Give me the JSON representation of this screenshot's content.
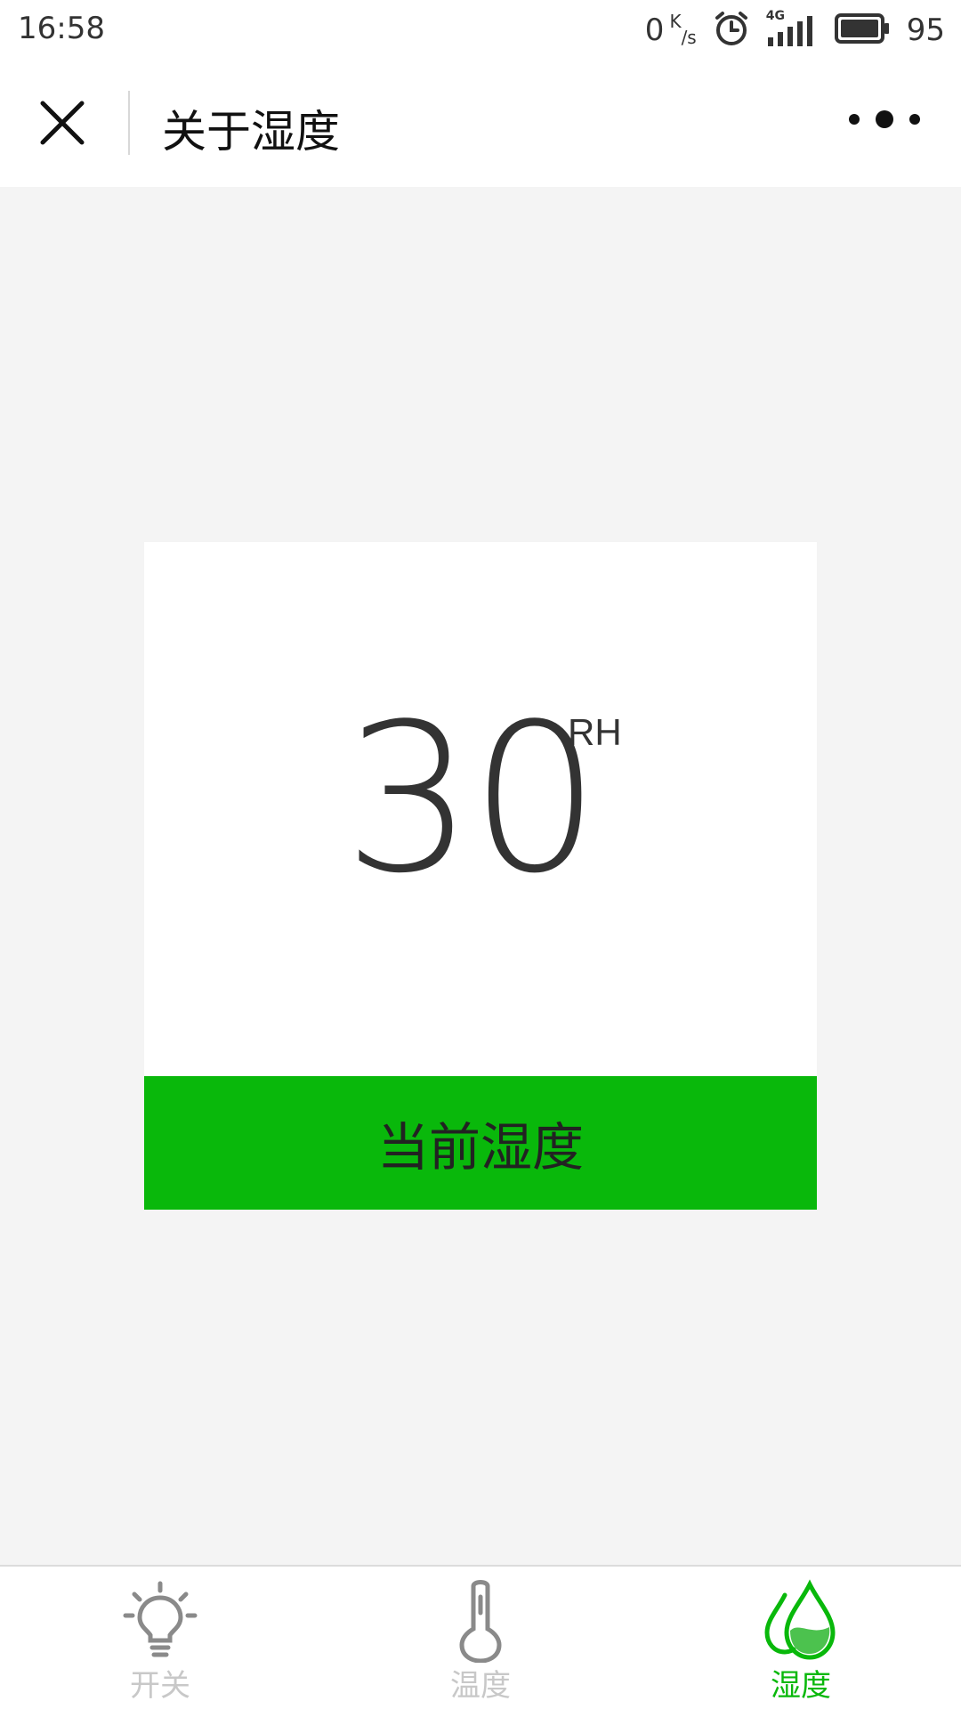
{
  "status_bar": {
    "time": "16:58",
    "net_speed_value": "0",
    "net_speed_unit_k": "K",
    "net_speed_unit_s": "/s",
    "network_type": "4G",
    "battery_percent": "95"
  },
  "nav": {
    "title": "关于湿度",
    "close_icon": "close-icon",
    "more_icon": "more-dots-icon"
  },
  "card": {
    "value": "30",
    "unit": "RH",
    "label": "当前湿度",
    "label_bg_color": "#09b80b"
  },
  "tabs": [
    {
      "label": "开关",
      "icon": "lightbulb-icon",
      "active": false
    },
    {
      "label": "温度",
      "icon": "thermometer-icon",
      "active": false
    },
    {
      "label": "湿度",
      "icon": "water-drop-icon",
      "active": true
    }
  ],
  "colors": {
    "accent": "#09b80b",
    "inactive_tab": "#c8c8c8",
    "page_bg": "#f4f4f4"
  }
}
